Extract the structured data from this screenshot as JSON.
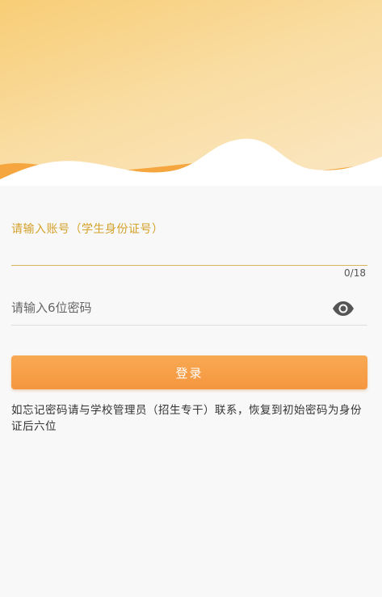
{
  "form": {
    "account_label": "请输入账号（学生身份证号）",
    "account_value": "",
    "account_counter": "0/18",
    "password_placeholder": "请输入6位密码",
    "password_value": "",
    "password_toggle_icon": "eye-icon",
    "login_label": "登录"
  },
  "notice": "如忘记密码请与学校管理员（招生专干）联系，恢复到初始密码为身份证后六位",
  "colors": {
    "accent": "#f5963f",
    "label": "#d4a12a",
    "header_start": "#f8cd76",
    "header_end": "#fbe7c4"
  }
}
